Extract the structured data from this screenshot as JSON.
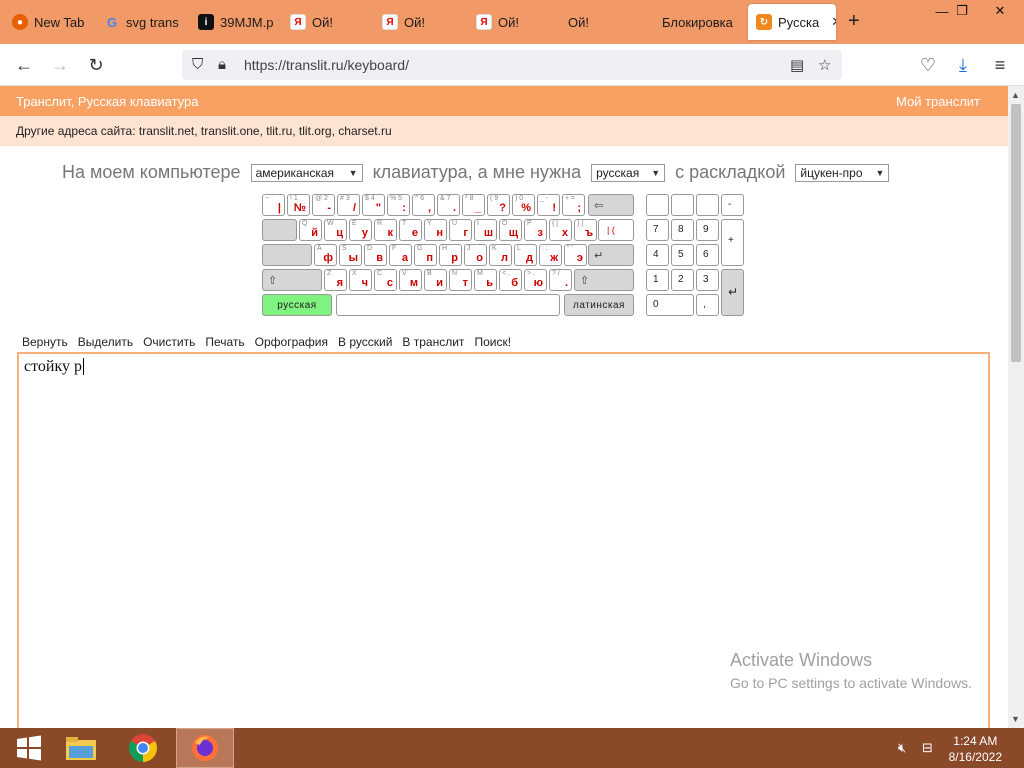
{
  "browser": {
    "tabs": [
      {
        "label": "New Tab",
        "icon": "firefox-icon",
        "color": "#e66000"
      },
      {
        "label": "svg trans",
        "icon": "google-icon",
        "color": "#4285f4"
      },
      {
        "label": "39MJM.p",
        "icon": "info-icon",
        "color": "#111111"
      },
      {
        "label": "Ой!",
        "icon": "yandex-icon",
        "color": "#ffffff"
      },
      {
        "label": "Ой!",
        "icon": "yandex-icon",
        "color": "#ffffff"
      },
      {
        "label": "Ой!",
        "icon": "yandex-icon",
        "color": "#ffffff"
      },
      {
        "label": "Ой!",
        "icon": "none",
        "color": ""
      },
      {
        "label": "Блокировка",
        "icon": "none",
        "color": ""
      },
      {
        "label": "Русска",
        "icon": "translit-icon",
        "color": "#f08a1c",
        "active": true
      }
    ],
    "url": "https://translit.ru/keyboard/"
  },
  "site": {
    "header_left": "Транслит, Русская клавиатура",
    "header_right": "Мой транслит",
    "other_addresses": "Другие адреса сайта: translit.net, translit.one, tlit.ru, tlit.org, charset.ru"
  },
  "selector": {
    "text1": "На моем компьютере",
    "sel1": "американская",
    "text2": "клавиатура, а мне нужна",
    "sel2": "русская",
    "text3": "с раскладкой",
    "sel3": "йцукен-про"
  },
  "keyboard": {
    "row1": [
      {
        "t": "~ `",
        "m": "|"
      },
      {
        "t": "! 1",
        "m": "№"
      },
      {
        "t": "@ 2",
        "m": "-"
      },
      {
        "t": "# 3",
        "m": "/"
      },
      {
        "t": "$ 4",
        "m": "\""
      },
      {
        "t": "% 5",
        "m": ":"
      },
      {
        "t": "^ 6",
        "m": ","
      },
      {
        "t": "& 7",
        "m": "."
      },
      {
        "t": "* 8",
        "m": "_"
      },
      {
        "t": "( 9",
        "m": "?"
      },
      {
        "t": ") 0",
        "m": "%"
      },
      {
        "t": "_ -",
        "m": "!"
      },
      {
        "t": "+ =",
        "m": ";"
      }
    ],
    "row2": [
      {
        "t": "Q",
        "m": "й"
      },
      {
        "t": "W",
        "m": "ц"
      },
      {
        "t": "E",
        "m": "у"
      },
      {
        "t": "R",
        "m": "к"
      },
      {
        "t": "T",
        "m": "е"
      },
      {
        "t": "Y",
        "m": "н"
      },
      {
        "t": "U",
        "m": "г"
      },
      {
        "t": "I",
        "m": "ш"
      },
      {
        "t": "O",
        "m": "щ"
      },
      {
        "t": "P",
        "m": "з"
      },
      {
        "t": "{ [",
        "m": "х"
      },
      {
        "t": "} ]",
        "m": "ъ"
      }
    ],
    "row3": [
      {
        "t": "A",
        "m": "ф"
      },
      {
        "t": "S",
        "m": "ы"
      },
      {
        "t": "D",
        "m": "в"
      },
      {
        "t": "F",
        "m": "а"
      },
      {
        "t": "G",
        "m": "п"
      },
      {
        "t": "H",
        "m": "р"
      },
      {
        "t": "J",
        "m": "о"
      },
      {
        "t": "K",
        "m": "л"
      },
      {
        "t": "L",
        "m": "д"
      },
      {
        "t": ": ;",
        "m": "ж"
      },
      {
        "t": "\" '",
        "m": "э"
      }
    ],
    "row4": [
      {
        "t": "Z",
        "m": "я"
      },
      {
        "t": "X",
        "m": "ч"
      },
      {
        "t": "C",
        "m": "с"
      },
      {
        "t": "V",
        "m": "м"
      },
      {
        "t": "B",
        "m": "и"
      },
      {
        "t": "N",
        "m": "т"
      },
      {
        "t": "M",
        "m": "ь"
      },
      {
        "t": "< ,",
        "m": "б"
      },
      {
        "t": "> .",
        "m": "ю"
      },
      {
        "t": "? /",
        "m": "."
      }
    ],
    "backspace": "⇦",
    "pipe_key": "| (",
    "enter": "↵",
    "shift": "⇧",
    "russian": "русская",
    "latin": "латинская",
    "numpad": [
      "-",
      "7",
      "8",
      "9",
      "+",
      "4",
      "5",
      "6",
      "1",
      "2",
      "3",
      "0",
      ",",
      "↵"
    ]
  },
  "toolbar": [
    "Вернуть",
    "Выделить",
    "Очистить",
    "Печать",
    "Орфография",
    "В русский",
    "В транслит",
    "Поиск!"
  ],
  "editor_text": "стойку р",
  "watermark": {
    "line1": "Activate Windows",
    "line2": "Go to PC settings to activate Windows."
  },
  "taskbar": {
    "time": "1:24 AM",
    "date": "8/16/2022"
  },
  "colors": {
    "tabstrip": "#f19a68",
    "site_orange": "#f8a162",
    "site_light": "#fde3d2",
    "key_red": "#cc0000",
    "green_key": "#7ff27f",
    "taskbar": "#8a4a2a"
  }
}
